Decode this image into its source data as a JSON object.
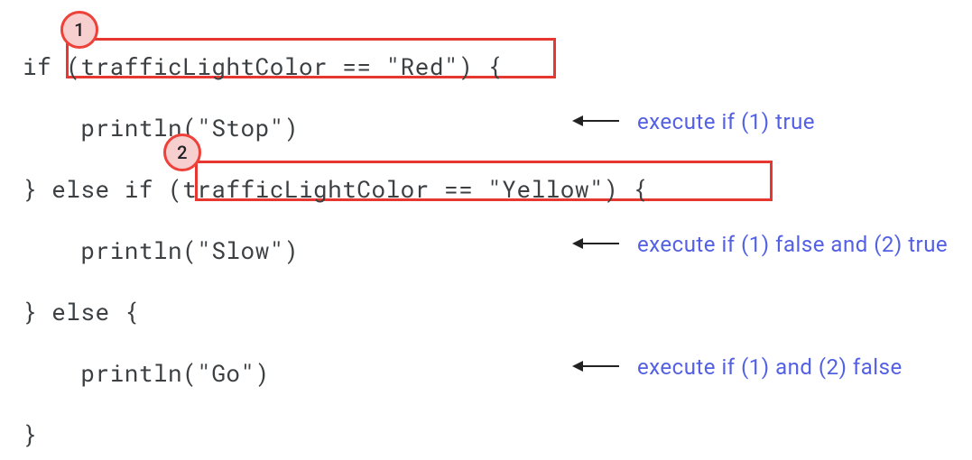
{
  "code": {
    "l1": "if (trafficLightColor == \"Red\") {",
    "l2": "    println(\"Stop\")",
    "l3": "} else if (trafficLightColor == \"Yellow\") {",
    "l4": "    println(\"Slow\")",
    "l5": "} else {",
    "l6": "    println(\"Go\")",
    "l7": "}"
  },
  "badges": {
    "b1": "1",
    "b2": "2"
  },
  "annotations": {
    "a1": "execute if (1) true",
    "a2": "execute if (1) false and (2) true",
    "a3": "execute if (1) and (2) false"
  }
}
